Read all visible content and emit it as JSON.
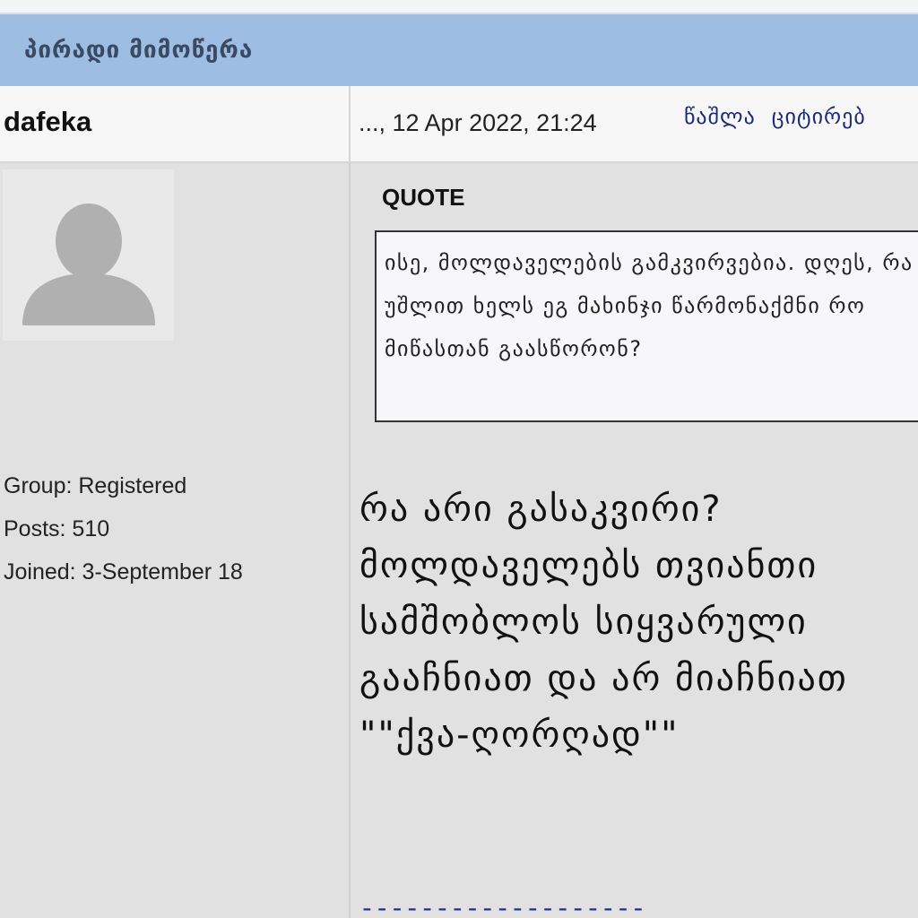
{
  "header": {
    "title": "პირადი მიმოწერა"
  },
  "post": {
    "author": "dafeka",
    "date": "..., 12 Apr 2022, 21:24",
    "actions": [
      {
        "label": "წაშლა"
      },
      {
        "label": "ციტირებ"
      }
    ],
    "author_info": {
      "group": "Group: Registered",
      "posts": "Posts: 510",
      "joined": "Joined: 3-September 18"
    },
    "quote": {
      "label": "QUOTE",
      "text": "ისე, მოლდაველების გამკვირვებია. დღეს, რა უშლით ხელს ეგ მახინჯი წარმონაქმნი რო მიწასთან გაასწორონ?"
    },
    "body": "რა არი გასაკვირი? მოლდაველებს თვიანთი სამშობლოს სიყვარული გააჩნიათ და არ მიაჩნიათ \"\"ქვა-ღორღად\"\"",
    "signature_divider": "-------------------"
  },
  "colors": {
    "title_bar": "#9ebde2",
    "background": "#e0e1e0",
    "link": "#1b2b7a"
  }
}
